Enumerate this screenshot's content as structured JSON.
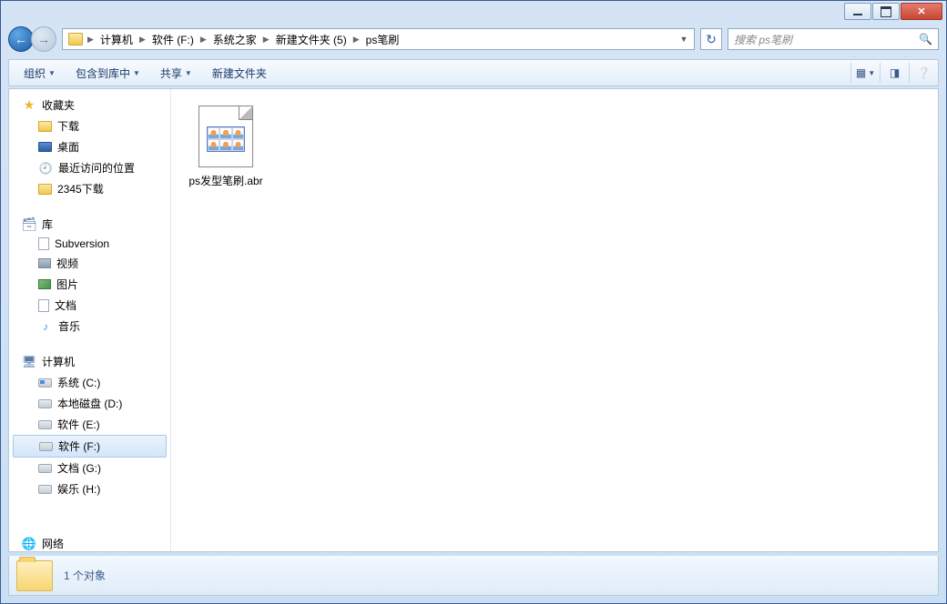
{
  "breadcrumbs": [
    "计算机",
    "软件 (F:)",
    "系统之家",
    "新建文件夹 (5)",
    "ps笔刷"
  ],
  "search": {
    "placeholder": "搜索 ps笔刷"
  },
  "toolbar": {
    "organize": "组织",
    "include": "包含到库中",
    "share": "共享",
    "newfolder": "新建文件夹"
  },
  "sidebar": {
    "favorites": {
      "label": "收藏夹",
      "items": [
        {
          "label": "下载",
          "icon": "folder"
        },
        {
          "label": "桌面",
          "icon": "desktop"
        },
        {
          "label": "最近访问的位置",
          "icon": "recent"
        },
        {
          "label": "2345下载",
          "icon": "folder"
        }
      ]
    },
    "libraries": {
      "label": "库",
      "items": [
        {
          "label": "Subversion",
          "icon": "doc"
        },
        {
          "label": "视频",
          "icon": "vid"
        },
        {
          "label": "图片",
          "icon": "pic"
        },
        {
          "label": "文档",
          "icon": "doc"
        },
        {
          "label": "音乐",
          "icon": "music"
        }
      ]
    },
    "computer": {
      "label": "计算机",
      "items": [
        {
          "label": "系统 (C:)",
          "icon": "drive-sys"
        },
        {
          "label": "本地磁盘 (D:)",
          "icon": "drive"
        },
        {
          "label": "软件 (E:)",
          "icon": "drive"
        },
        {
          "label": "软件 (F:)",
          "icon": "drive",
          "selected": true
        },
        {
          "label": "文档 (G:)",
          "icon": "drive"
        },
        {
          "label": "娱乐 (H:)",
          "icon": "drive"
        }
      ]
    },
    "network": {
      "label": "网络"
    }
  },
  "files": [
    {
      "name": "ps发型笔刷.abr"
    }
  ],
  "status": {
    "text": "1 个对象"
  }
}
